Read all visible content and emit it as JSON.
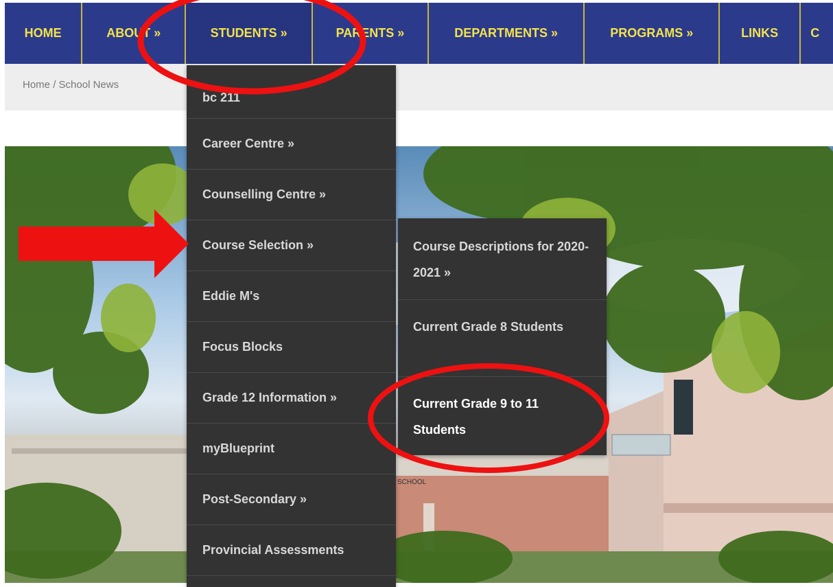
{
  "nav": {
    "items": [
      {
        "label": "HOME"
      },
      {
        "label": "ABOUT »"
      },
      {
        "label": "STUDENTS »"
      },
      {
        "label": "PARENTS »"
      },
      {
        "label": "DEPARTMENTS »"
      },
      {
        "label": "PROGRAMS »"
      },
      {
        "label": "LINKS"
      },
      {
        "label": "C"
      }
    ]
  },
  "breadcrumb": {
    "home": "Home",
    "sep": "/",
    "current": "School News"
  },
  "students_menu": {
    "items": [
      {
        "label": "bc 211"
      },
      {
        "label": "Career Centre »"
      },
      {
        "label": "Counselling Centre »"
      },
      {
        "label": "Course Selection »"
      },
      {
        "label": "Eddie M's"
      },
      {
        "label": "Focus Blocks"
      },
      {
        "label": "Grade 12 Information »"
      },
      {
        "label": "myBlueprint"
      },
      {
        "label": "Post-Secondary »"
      },
      {
        "label": "Provincial Assessments"
      }
    ]
  },
  "course_selection_menu": {
    "items": [
      {
        "label": "Course Descriptions for 2020-2021 »"
      },
      {
        "label": "Current Grade 8 Students"
      },
      {
        "label": "Current Grade 9 to 11 Students"
      }
    ]
  },
  "hero": {
    "sign_text": "SCHOOL"
  },
  "colors": {
    "nav_bg": "#2c3a8c",
    "nav_text": "#f3e34a",
    "menu_bg": "#333333",
    "annotation": "#ee1111"
  }
}
